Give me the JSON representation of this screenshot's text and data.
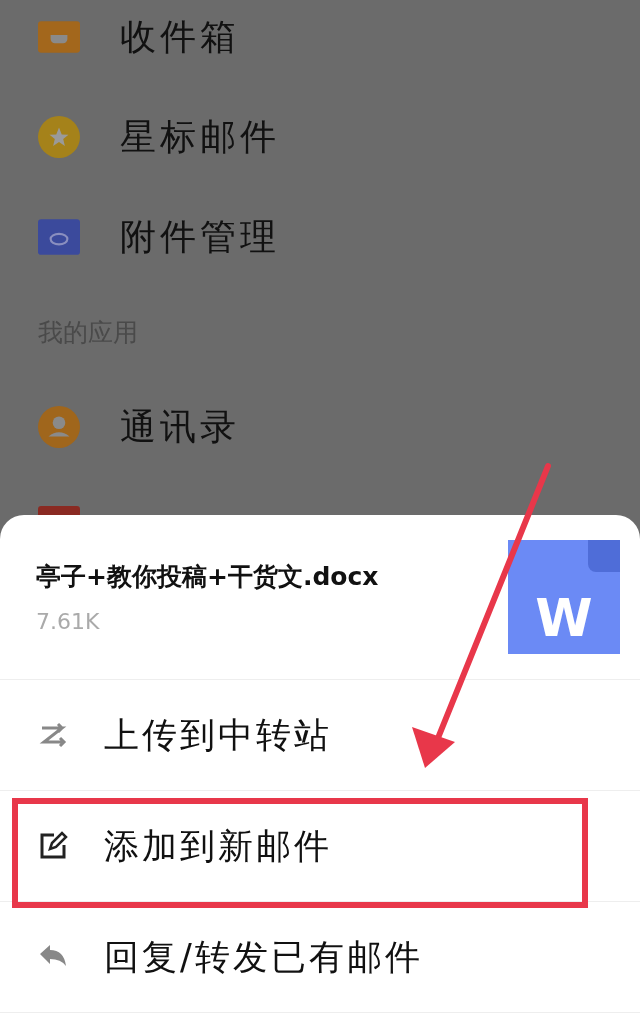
{
  "menu": [
    {
      "kind": "inbox",
      "label": "收件箱"
    },
    {
      "kind": "star",
      "label": "星标邮件"
    },
    {
      "kind": "attachment",
      "label": "附件管理"
    }
  ],
  "section_title": "我的应用",
  "apps": [
    {
      "kind": "contacts",
      "label": "通讯录"
    },
    {
      "kind": "calendar"
    }
  ],
  "sheet": {
    "file_name": "亭子+教你投稿+干货文.docx",
    "file_size": "7.61K",
    "file_badge": "W",
    "actions": [
      {
        "kind": "transfer",
        "label": "上传到中转站",
        "highlighted": false
      },
      {
        "kind": "edit",
        "label": "添加到新邮件",
        "highlighted": true
      },
      {
        "kind": "reply",
        "label": "回复/转发已有邮件",
        "highlighted": false
      }
    ]
  }
}
